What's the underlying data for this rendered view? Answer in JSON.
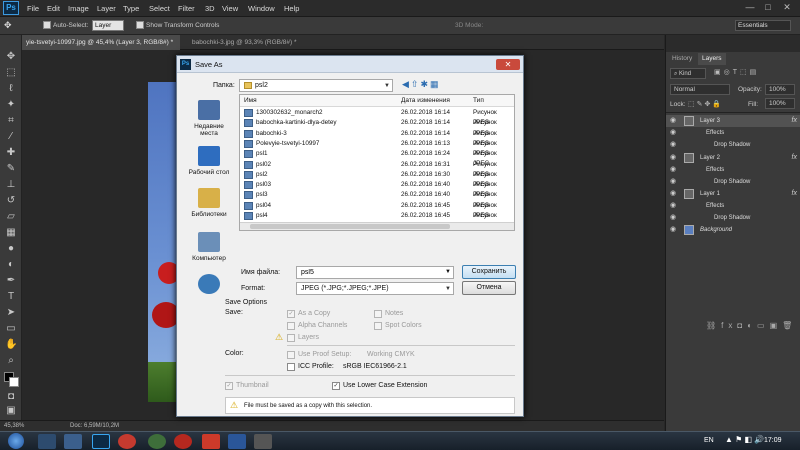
{
  "app": {
    "logo": "Ps"
  },
  "menu": [
    "File",
    "Edit",
    "Image",
    "Layer",
    "Type",
    "Select",
    "Filter",
    "3D",
    "View",
    "Window",
    "Help"
  ],
  "window_controls": [
    "—",
    "□",
    "✕"
  ],
  "options_bar": {
    "auto_select_label": "Auto-Select:",
    "auto_select_value": "Layer",
    "show_transform": "Show Transform Controls",
    "mode_3d": "3D Mode:",
    "workspace": "Essentials"
  },
  "doc_tabs": [
    "yie-tsvetyi-10997.jpg @ 45,4% (Layer 3, RGB/8#) *",
    "babochki-3.jpg @ 93,3% (RGB/8#) *"
  ],
  "status": {
    "zoom": "45,38%",
    "doc": "Doc: 6,59M/10,2M"
  },
  "panels": {
    "tabs": [
      "History",
      "Layers"
    ],
    "kind": "Kind",
    "blend_mode": "Normal",
    "opacity_label": "Opacity:",
    "opacity_value": "100%",
    "lock_label": "Lock:",
    "fill_label": "Fill:",
    "fill_value": "100%",
    "layers": [
      {
        "name": "Layer 3",
        "selected": true,
        "fx": "fx"
      },
      {
        "name": "Effects",
        "sub": true
      },
      {
        "name": "Drop Shadow",
        "sub": true
      },
      {
        "name": "Layer 2",
        "fx": "fx"
      },
      {
        "name": "Effects",
        "sub": true
      },
      {
        "name": "Drop Shadow",
        "sub": true
      },
      {
        "name": "Layer 1",
        "fx": "fx"
      },
      {
        "name": "Effects",
        "sub": true
      },
      {
        "name": "Drop Shadow",
        "sub": true
      },
      {
        "name": "Background"
      }
    ]
  },
  "dialog": {
    "title": "Save As",
    "folder_label": "Папка:",
    "folder_value": "psl2",
    "places": [
      "Недавние места",
      "Рабочий стол",
      "Библиотеки",
      "Компьютер",
      "Сеть"
    ],
    "columns": {
      "name": "Имя",
      "date": "Дата изменения",
      "type": "Тип"
    },
    "files": [
      {
        "name": "1300302632_monarch2",
        "date": "26.02.2018 16:14",
        "type": "Рисунок JPEG"
      },
      {
        "name": "babochka-kartinki-dlya-detey",
        "date": "26.02.2018 16:14",
        "type": "Рисунок JPEG"
      },
      {
        "name": "babochki-3",
        "date": "26.02.2018 16:14",
        "type": "Рисунок JPEG"
      },
      {
        "name": "Polevyie-tsvetyi-10997",
        "date": "26.02.2018 16:13",
        "type": "Рисунок JPEG"
      },
      {
        "name": "psl1",
        "date": "26.02.2018 16:24",
        "type": "Рисунок JPEG"
      },
      {
        "name": "psl02",
        "date": "26.02.2018 16:31",
        "type": "Рисунок JPEG"
      },
      {
        "name": "psl2",
        "date": "26.02.2018 16:30",
        "type": "Рисунок JPEG"
      },
      {
        "name": "psl03",
        "date": "26.02.2018 16:40",
        "type": "Рисунок JPEG"
      },
      {
        "name": "psl3",
        "date": "26.02.2018 16:40",
        "type": "Рисунок JPEG"
      },
      {
        "name": "psl04",
        "date": "26.02.2018 16:45",
        "type": "Рисунок JPEG"
      },
      {
        "name": "psl4",
        "date": "26.02.2018 16:45",
        "type": "Рисунок JPEG"
      }
    ],
    "filename_label": "Имя файла:",
    "filename_value": "psl5",
    "format_label": "Format:",
    "format_value": "JPEG (*.JPG;*.JPEG;*.JPE)",
    "save_button": "Сохранить",
    "cancel_button": "Отмена",
    "save_options_title": "Save Options",
    "save_label": "Save:",
    "opt_as_copy": "As a Copy",
    "opt_notes": "Notes",
    "opt_alpha": "Alpha Channels",
    "opt_spot": "Spot Colors",
    "opt_layers": "Layers",
    "color_label": "Color:",
    "opt_proof": "Use Proof Setup:",
    "proof_value": "Working CMYK",
    "opt_icc": "ICC Profile:",
    "icc_value": "sRGB IEC61966-2.1",
    "opt_thumbnail": "Thumbnail",
    "opt_lowercase": "Use Lower Case Extension",
    "warning": "File must be saved as a copy with this selection."
  },
  "taskbar": {
    "lang": "EN",
    "time": "17:09"
  }
}
